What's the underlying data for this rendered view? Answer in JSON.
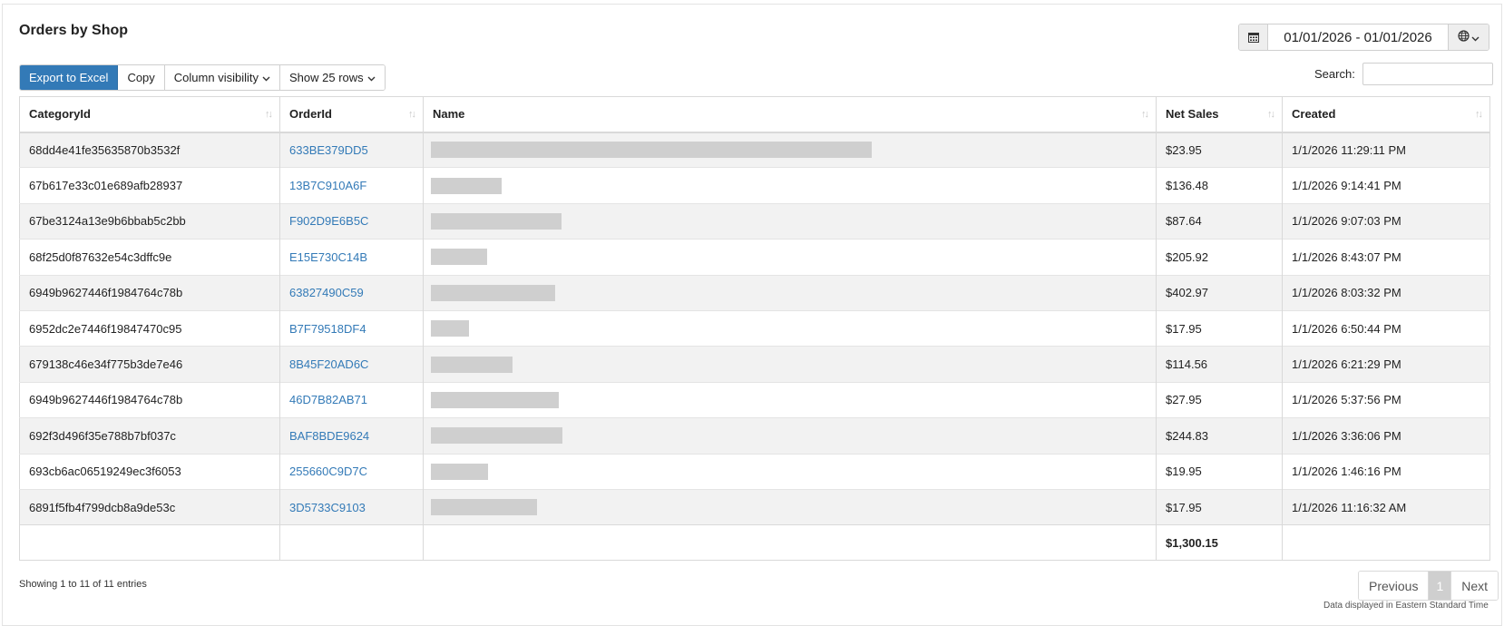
{
  "header": {
    "title": "Orders by Shop"
  },
  "date_range": {
    "value": "01/01/2026 - 01/01/2026",
    "calendar_icon": "calendar-icon",
    "globe_icon": "globe-icon"
  },
  "toolbar": {
    "export_label": "Export to Excel",
    "copy_label": "Copy",
    "column_visibility_label": "Column visibility",
    "show_rows_label": "Show 25 rows"
  },
  "search": {
    "label": "Search:",
    "value": ""
  },
  "table": {
    "columns": [
      "CategoryId",
      "OrderId",
      "Name",
      "Net Sales",
      "Created"
    ],
    "rows": [
      {
        "category_id": "68dd4e41fe35635870b3532f",
        "order_id": "633BE379DD5",
        "net_sales": "$23.95",
        "created": "1/1/2026 11:29:11 PM"
      },
      {
        "category_id": "67b617e33c01e689afb28937",
        "order_id": "13B7C910A6F",
        "net_sales": "$136.48",
        "created": "1/1/2026 9:14:41 PM"
      },
      {
        "category_id": "67be3124a13e9b6bbab5c2bb",
        "order_id": "F902D9E6B5C",
        "net_sales": "$87.64",
        "created": "1/1/2026 9:07:03 PM"
      },
      {
        "category_id": "68f25d0f87632e54c3dffc9e",
        "order_id": "E15E730C14B",
        "net_sales": "$205.92",
        "created": "1/1/2026 8:43:07 PM"
      },
      {
        "category_id": "6949b9627446f1984764c78b",
        "order_id": "63827490C59",
        "net_sales": "$402.97",
        "created": "1/1/2026 8:03:32 PM"
      },
      {
        "category_id": "6952dc2e7446f19847470c95",
        "order_id": "B7F79518DF4",
        "net_sales": "$17.95",
        "created": "1/1/2026 6:50:44 PM"
      },
      {
        "category_id": "679138c46e34f775b3de7e46",
        "order_id": "8B45F20AD6C",
        "net_sales": "$114.56",
        "created": "1/1/2026 6:21:29 PM"
      },
      {
        "category_id": "6949b9627446f1984764c78b",
        "order_id": "46D7B82AB71",
        "net_sales": "$27.95",
        "created": "1/1/2026 5:37:56 PM"
      },
      {
        "category_id": "692f3d496f35e788b7bf037c",
        "order_id": "BAF8BDE9624",
        "net_sales": "$244.83",
        "created": "1/1/2026 3:36:06 PM"
      },
      {
        "category_id": "693cb6ac06519249ec3f6053",
        "order_id": "255660C9D7C",
        "net_sales": "$19.95",
        "created": "1/1/2026 1:46:16 PM"
      },
      {
        "category_id": "6891f5fb4f799dcb8a9de53c",
        "order_id": "3D5733C9103",
        "net_sales": "$17.95",
        "created": "1/1/2026 11:16:32 AM"
      }
    ],
    "total_net_sales": "$1,300.15"
  },
  "footer": {
    "info": "Showing 1 to 11 of 11 entries",
    "pagination": {
      "previous": "Previous",
      "page": "1",
      "next": "Next"
    },
    "timezone_note": "Data displayed in Eastern Standard Time"
  },
  "colors": {
    "primary": "#337ab7",
    "link": "#337ab7",
    "stripe": "#f2f2f2",
    "redaction": "#cfcfcf"
  }
}
